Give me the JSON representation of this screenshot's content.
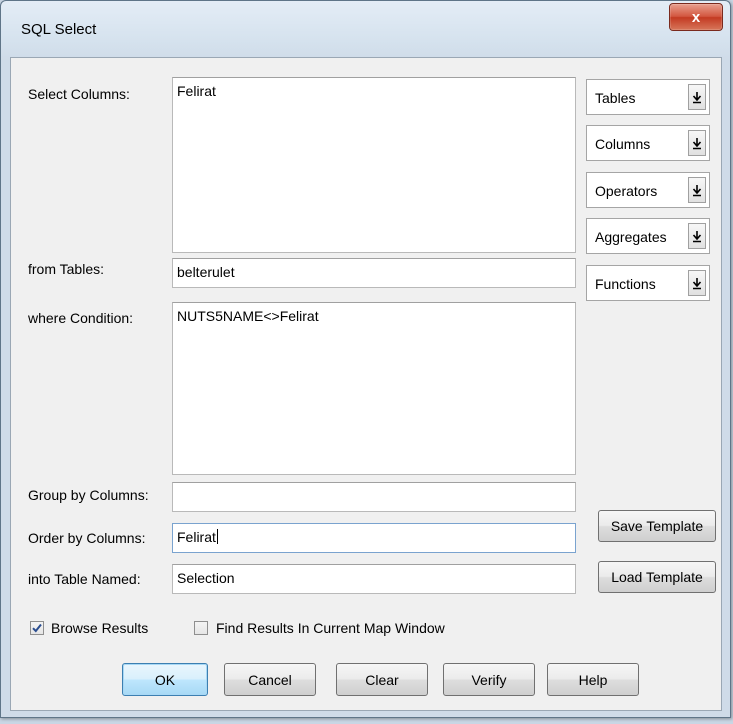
{
  "window": {
    "title": "SQL Select",
    "close_symbol": "x"
  },
  "labels": {
    "select_columns": "Select Columns:",
    "from_tables": "from Tables:",
    "where_condition": "where Condition:",
    "group_by": "Group by Columns:",
    "order_by": "Order by Columns:",
    "into_table": "into Table Named:"
  },
  "fields": {
    "select_columns": "Felirat",
    "from_tables": "belterulet",
    "where_condition": "NUTS5NAME<>Felirat",
    "group_by": "",
    "order_by": "Felirat",
    "into_table": "Selection"
  },
  "dropdowns": [
    {
      "label": "Tables"
    },
    {
      "label": "Columns"
    },
    {
      "label": "Operators"
    },
    {
      "label": "Aggregates"
    },
    {
      "label": "Functions"
    }
  ],
  "template_buttons": {
    "save": "Save Template",
    "load": "Load Template"
  },
  "checkboxes": {
    "browse_results": {
      "label": "Browse Results",
      "checked": true
    },
    "find_results": {
      "label": "Find Results In Current Map Window",
      "checked": false
    }
  },
  "buttons": {
    "ok": "OK",
    "cancel": "Cancel",
    "clear": "Clear",
    "verify": "Verify",
    "help": "Help"
  }
}
